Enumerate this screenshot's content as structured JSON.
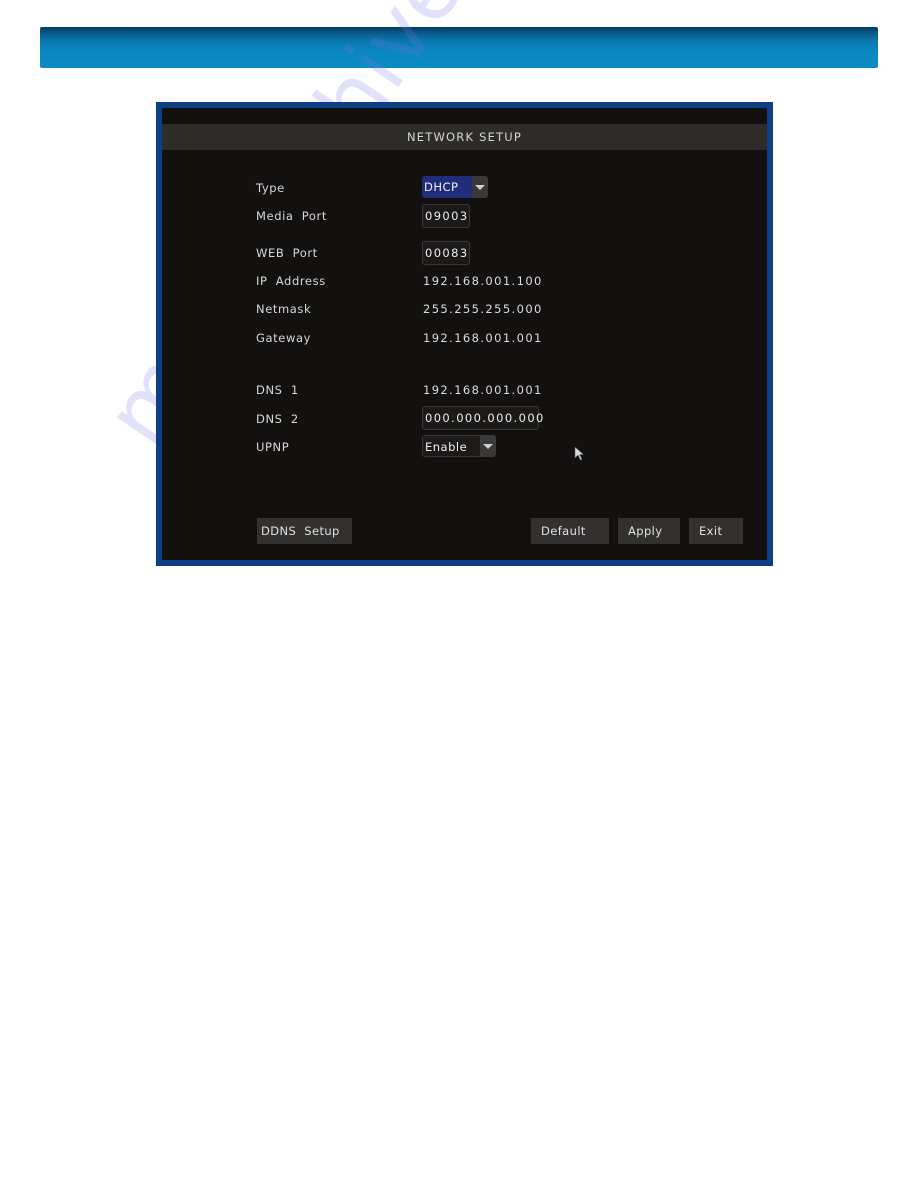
{
  "window": {
    "title": "NETWORK SETUP"
  },
  "colors": {
    "header_bar": "#0b8cc6",
    "frame_border": "#0e3f86",
    "screen_bg": "#131110",
    "dhcp_highlight": "#1f2d7a"
  },
  "fields": {
    "type": {
      "label": "Type",
      "value": "DHCP",
      "icon": "chevron-down-icon"
    },
    "media_port": {
      "label": "Media  Port",
      "value": "09003"
    },
    "web_port": {
      "label": "WEB  Port",
      "value": "00083"
    },
    "ip_address": {
      "label": "IP  Address",
      "value": "192.168.001.100"
    },
    "netmask": {
      "label": "Netmask",
      "value": "255.255.255.000"
    },
    "gateway": {
      "label": "Gateway",
      "value": "192.168.001.001"
    },
    "dns1": {
      "label": "DNS  1",
      "value": "192.168.001.001"
    },
    "dns2": {
      "label": "DNS  2",
      "value": "000.000.000.000"
    },
    "upnp": {
      "label": "UPNP",
      "value": "Enable",
      "icon": "chevron-down-icon"
    }
  },
  "buttons": {
    "ddns_setup": "DDNS  Setup",
    "default": "Default",
    "apply": "Apply",
    "exit": "Exit"
  },
  "watermark": "manualshive.com"
}
